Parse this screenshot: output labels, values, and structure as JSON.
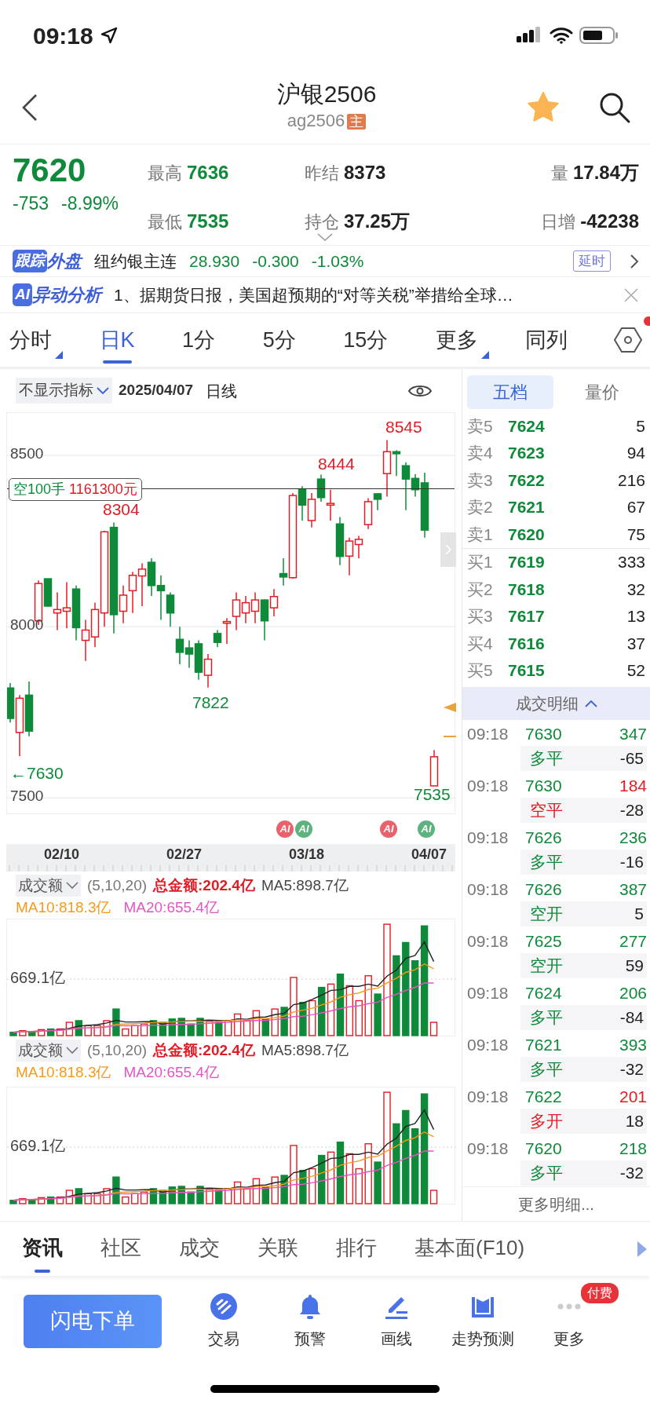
{
  "status_bar": {
    "time": "09:18"
  },
  "header": {
    "title": "沪银2506",
    "code": "ag2506",
    "code_badge": "主",
    "favorite": true
  },
  "quote": {
    "price": "7620",
    "change": "-753",
    "change_pct": "-8.99%",
    "stats": [
      {
        "label": "最高",
        "value": "7636",
        "color": "#0f8a3a"
      },
      {
        "label": "昨结",
        "value": "8373",
        "color": "#222222"
      },
      {
        "label": "量",
        "value": "17.84万",
        "color": "#222222"
      },
      {
        "label": "最低",
        "value": "7535",
        "color": "#0f8a3a"
      },
      {
        "label": "持仓",
        "value": "37.25万",
        "color": "#222222"
      },
      {
        "label": "日增",
        "value": "-42238",
        "color": "#222222"
      }
    ]
  },
  "foreign": {
    "badge": "跟踪",
    "title": "外盘",
    "name": "纽约银主连",
    "price": "28.930",
    "change": "-0.300",
    "change_pct": "-1.03%",
    "delay": "延时"
  },
  "ai_news": {
    "badge": "AI",
    "title": "异动分析",
    "text": "1、据期货日报，美国超预期的“对等关税”举措给全球…"
  },
  "period_tabs": [
    {
      "label": "分时",
      "selected": false,
      "dropdown": true
    },
    {
      "label": "日K",
      "selected": true,
      "dropdown": false
    },
    {
      "label": "1分",
      "selected": false,
      "dropdown": false
    },
    {
      "label": "5分",
      "selected": false,
      "dropdown": false
    },
    {
      "label": "15分",
      "selected": false,
      "dropdown": false
    },
    {
      "label": "更多",
      "selected": false,
      "dropdown": true
    },
    {
      "label": "同列",
      "selected": false,
      "dropdown": false
    }
  ],
  "chart_toolbar": {
    "indicator": "不显示指标",
    "date": "2025/04/07",
    "period": "日线"
  },
  "kline": {
    "chart_data": {
      "type": "candlestick",
      "ohlc": [
        [
          7821,
          7835,
          7720,
          7732
        ],
        [
          7691,
          7800,
          7622,
          7791
        ],
        [
          7800,
          7840,
          7680,
          7695
        ],
        [
          8017,
          8135,
          8005,
          8126
        ],
        [
          8140,
          8140,
          8058,
          8060
        ],
        [
          8040,
          8100,
          7990,
          8050
        ],
        [
          8045,
          8130,
          7995,
          8055
        ],
        [
          8110,
          8120,
          7960,
          7997
        ],
        [
          7960,
          8020,
          7900,
          7990
        ],
        [
          7970,
          8070,
          7940,
          8050
        ],
        [
          8040,
          8280,
          8000,
          8277
        ],
        [
          8290,
          8304,
          7980,
          8035
        ],
        [
          8045,
          8120,
          8010,
          8092
        ],
        [
          8105,
          8160,
          8040,
          8150
        ],
        [
          8148,
          8185,
          8060,
          8168
        ],
        [
          8188,
          8200,
          8090,
          8120
        ],
        [
          8120,
          8150,
          8020,
          8105
        ],
        [
          8092,
          8100,
          8000,
          8040
        ],
        [
          7963,
          8000,
          7890,
          7925
        ],
        [
          7938,
          7960,
          7880,
          7920
        ],
        [
          7950,
          7960,
          7845,
          7867
        ],
        [
          7858,
          7920,
          7822,
          7905
        ],
        [
          7980,
          7990,
          7940,
          7954
        ],
        [
          8010,
          8025,
          7950,
          8015
        ],
        [
          8030,
          8100,
          7990,
          8078
        ],
        [
          8040,
          8090,
          8010,
          8070
        ],
        [
          8045,
          8100,
          8010,
          8078
        ],
        [
          8078,
          8080,
          7960,
          8017
        ],
        [
          8055,
          8110,
          8030,
          8088
        ],
        [
          8155,
          8200,
          8120,
          8145
        ],
        [
          8143,
          8390,
          8140,
          8383
        ],
        [
          8400,
          8410,
          8310,
          8355
        ],
        [
          8310,
          8390,
          8290,
          8372
        ],
        [
          8431,
          8444,
          8365,
          8377
        ],
        [
          8355,
          8400,
          8310,
          8360
        ],
        [
          8300,
          8320,
          8180,
          8205
        ],
        [
          8206,
          8260,
          8150,
          8250
        ],
        [
          8240,
          8265,
          8200,
          8255
        ],
        [
          8298,
          8375,
          8285,
          8365
        ],
        [
          8388,
          8390,
          8340,
          8372
        ],
        [
          8447,
          8545,
          8380,
          8511
        ],
        [
          8511,
          8515,
          8440,
          8505
        ],
        [
          8470,
          8480,
          8340,
          8431
        ],
        [
          8433,
          8445,
          8380,
          8400
        ],
        [
          8420,
          8450,
          8260,
          8282
        ],
        [
          7535,
          7640,
          7535,
          7620
        ]
      ],
      "yticks": [
        {
          "value": 8500,
          "label": "8500"
        },
        {
          "value": 8000,
          "label": "8000"
        },
        {
          "value": 7500,
          "label": "7500"
        }
      ],
      "ylim": [
        7450,
        8624
      ],
      "grid": true
    },
    "dates": [
      "02/10",
      "02/27",
      "03/18",
      "04/07"
    ],
    "position_tag": {
      "side": "空100手",
      "amount": "1161300元"
    },
    "price_marks": [
      {
        "text": "8545",
        "color": "#e01c24"
      },
      {
        "text": "8444",
        "color": "#e01c24"
      },
      {
        "text": "8304",
        "color": "#e01c24"
      },
      {
        "text": "7822",
        "color": "#0f8a3a"
      },
      {
        "text": "←7630",
        "color": "#0f8a3a"
      },
      {
        "text": "7535",
        "color": "#0f8a3a"
      }
    ],
    "ai_markers": [
      {
        "text": "AI",
        "color": "#e8616b"
      },
      {
        "text": "AI",
        "color": "#5db37e"
      },
      {
        "text": "AI",
        "color": "#e8616b"
      },
      {
        "text": "AI",
        "color": "#5db37e"
      }
    ]
  },
  "volume_panels": [
    {
      "indicator": "成交额",
      "params": "(5,10,20)",
      "total": "总金额:202.4亿",
      "ma5": "MA5:898.7亿",
      "ma10": "MA10:818.3亿",
      "ma20": "MA20:655.4亿",
      "axis_label": "669.1亿"
    },
    {
      "indicator": "成交额",
      "params": "(5,10,20)",
      "total": "总金额:202.4亿",
      "ma5": "MA5:898.7亿",
      "ma10": "MA10:818.3亿",
      "ma20": "MA20:655.4亿",
      "axis_label": "669.1亿"
    }
  ],
  "depth_tabs": [
    {
      "label": "五档",
      "selected": true
    },
    {
      "label": "量价",
      "selected": false
    }
  ],
  "asks": [
    {
      "label": "卖5",
      "price": "7624",
      "volume": "5"
    },
    {
      "label": "卖4",
      "price": "7623",
      "volume": "94"
    },
    {
      "label": "卖3",
      "price": "7622",
      "volume": "216"
    },
    {
      "label": "卖2",
      "price": "7621",
      "volume": "67"
    },
    {
      "label": "卖1",
      "price": "7620",
      "volume": "75"
    }
  ],
  "bids": [
    {
      "label": "买1",
      "price": "7619",
      "volume": "333"
    },
    {
      "label": "买2",
      "price": "7618",
      "volume": "32"
    },
    {
      "label": "买3",
      "price": "7617",
      "volume": "13"
    },
    {
      "label": "买4",
      "price": "7616",
      "volume": "37"
    },
    {
      "label": "买5",
      "price": "7615",
      "volume": "52"
    }
  ],
  "trades_header": {
    "title": "成交明细",
    "expanded": true
  },
  "trades": [
    {
      "time": "09:18",
      "price": "7630",
      "volume": "347",
      "type": "多平",
      "change": "-65",
      "color": "#0f8a3a"
    },
    {
      "time": "09:18",
      "price": "7630",
      "volume": "184",
      "type": "空平",
      "change": "-28",
      "color": "#e01c24"
    },
    {
      "time": "09:18",
      "price": "7626",
      "volume": "236",
      "type": "多平",
      "change": "-16",
      "color": "#0f8a3a"
    },
    {
      "time": "09:18",
      "price": "7626",
      "volume": "387",
      "type": "空开",
      "change": "5",
      "color": "#0f8a3a"
    },
    {
      "time": "09:18",
      "price": "7625",
      "volume": "277",
      "type": "空开",
      "change": "59",
      "color": "#0f8a3a"
    },
    {
      "time": "09:18",
      "price": "7624",
      "volume": "206",
      "type": "多平",
      "change": "-84",
      "color": "#0f8a3a"
    },
    {
      "time": "09:18",
      "price": "7621",
      "volume": "393",
      "type": "多平",
      "change": "-32",
      "color": "#0f8a3a"
    },
    {
      "time": "09:18",
      "price": "7622",
      "volume": "201",
      "type": "多开",
      "change": "18",
      "color": "#e01c24"
    },
    {
      "time": "09:18",
      "price": "7620",
      "volume": "218",
      "type": "多平",
      "change": "-32",
      "color": "#0f8a3a"
    }
  ],
  "more_trades": "更多明细...",
  "info_tabs": [
    {
      "label": "资讯",
      "selected": true
    },
    {
      "label": "社区",
      "selected": false
    },
    {
      "label": "成交",
      "selected": false
    },
    {
      "label": "关联",
      "selected": false
    },
    {
      "label": "排行",
      "selected": false
    },
    {
      "label": "基本面(F10)",
      "selected": false
    }
  ],
  "order_button": "闪电下单",
  "actions": [
    {
      "kind": "trade",
      "label": "交易"
    },
    {
      "kind": "alert",
      "label": "预警"
    },
    {
      "kind": "draw",
      "label": "画线"
    },
    {
      "kind": "forecast",
      "label": "走势预测"
    },
    {
      "kind": "more",
      "label": "更多",
      "badge": "付费"
    }
  ]
}
